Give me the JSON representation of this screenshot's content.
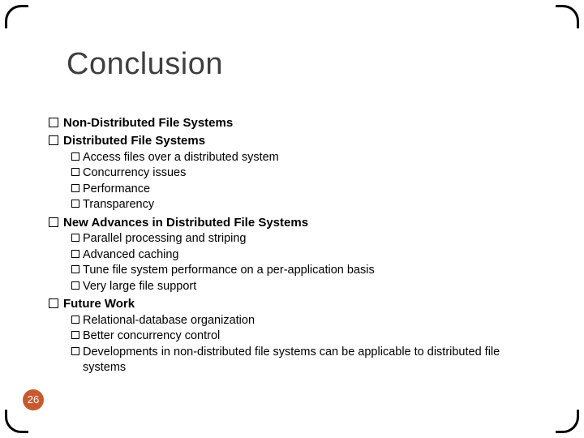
{
  "title": "Conclusion",
  "page_number": "26",
  "bullets": {
    "b1": "Non-Distributed File Systems",
    "b2": "Distributed File Systems",
    "b2_sub": [
      "Access files over a distributed system",
      "Concurrency issues",
      "Performance",
      "Transparency"
    ],
    "b3": "New Advances in Distributed File Systems",
    "b3_sub": [
      "Parallel processing and striping",
      "Advanced caching",
      "Tune file system performance on a per-application basis",
      "Very large file support"
    ],
    "b4": "Future Work",
    "b4_sub": [
      "Relational-database organization",
      "Better concurrency control",
      "Developments in non-distributed file systems can be applicable to distributed file systems"
    ]
  }
}
